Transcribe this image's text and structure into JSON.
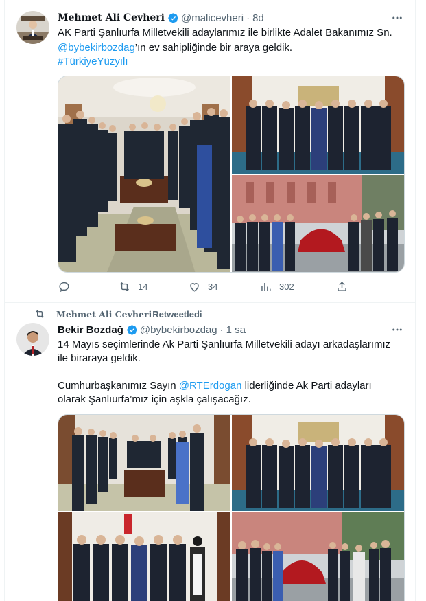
{
  "colors": {
    "accent": "#1d9bf0",
    "text": "#0f1419",
    "muted": "#536471",
    "border": "#cfd9de"
  },
  "tweet1": {
    "name": "Mehmet Ali Cevheri",
    "handle": "@malicevheri",
    "separator": "·",
    "time": "8d",
    "line1": "AK Parti Şanlıurfa Milletvekili adaylarımız ile birlikte Adalet Bakanımız Sn.",
    "mention": "@bybekirbozdag",
    "line2_rest": "’ın ev sahipliğinde bir araya geldik.",
    "hashtag": "#TürkiyeYüzyılı",
    "replies": "",
    "retweets": "14",
    "likes": "34",
    "views": "302",
    "icons": [
      "more-icon",
      "reply-icon",
      "retweet-icon",
      "like-icon",
      "views-icon",
      "share-icon",
      "verified-icon"
    ]
  },
  "retweet_banner": {
    "name": "Mehmet Ali Cevheri",
    "suffix": "Retweetledi"
  },
  "tweet2": {
    "name": "Bekir Bozdağ",
    "handle": "@bybekirbozdag",
    "separator": "·",
    "time": "1 sa",
    "line1": "14 Mayıs seçimlerinde Ak Parti Şanlıurfa Milletvekili adayı arkadaşlarımız",
    "line2": "ile biraraya geldik.",
    "line3_prefix": "Cumhurbaşkanımız Sayın ",
    "mention": "@RTErdogan",
    "line3_suffix": " liderliğinde Ak Parti adayları",
    "line4": "olarak Şanlıurfa’mız için aşkla çalışacağız."
  }
}
